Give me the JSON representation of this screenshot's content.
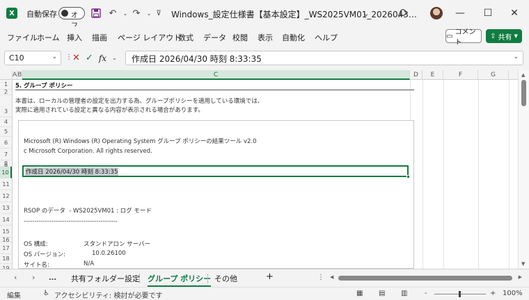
{
  "titlebar": {
    "app_icon": "X",
    "autosave_label": "自動保存",
    "toggle_label": "オフ",
    "doc_title": "Windows_設定仕様書【基本設定】_WS2025VM01_2026043…",
    "title_dropdown": "⌄"
  },
  "menu": [
    "ファイル",
    "ホーム",
    "挿入",
    "描画",
    "ページ レイアウト",
    "数式",
    "データ",
    "校閲",
    "表示",
    "自動化",
    "ヘルプ"
  ],
  "buttons": {
    "comment": "コメント",
    "share": "共有"
  },
  "formula": {
    "cell_ref": "C10",
    "content": "作成日 2026/04/30 時刻 8:33:35"
  },
  "columns": [
    "A",
    "B",
    "C",
    "D",
    "E",
    "F",
    "G"
  ],
  "rows": [
    "1",
    "2",
    "3",
    "4",
    "5",
    "6",
    "7",
    "8",
    "9",
    "10",
    "11",
    "12",
    "13",
    "14",
    "15",
    "16",
    "17",
    "18",
    "19"
  ],
  "sheet": {
    "heading": "5. グループ ポリシー",
    "note_line1": "本書は、ローカルの管理者の設定を出力する為、グループポリシーを適用している環境では、",
    "note_line2": "実際に適用されている設定と異なる内容が表示される場合があります。",
    "ms_line1": "Microsoft (R) Windows (R) Operating System グループ ポリシーの結果ツール v2.0",
    "ms_line2": "c Microsoft Corporation. All rights reserved.",
    "active_text": "作成日 2026/04/30 時刻 8:33:35",
    "rsop_title": "RSOP のデータ  - WS2025VM01 : ログ モード",
    "dashes": "--------------------------------------------",
    "os_config_label": "OS 構成:",
    "os_config_value": "スタンドアロン サーバー",
    "os_version_label": "OS バージョン:",
    "os_version_value": "10.0.26100",
    "site_label": "サイト名:",
    "site_value": "N/A"
  },
  "tabs": {
    "tab1": "共有フォルダー設定",
    "tab2": "グループ ポリシー",
    "tab3": "その他",
    "add": "+",
    "more": "…"
  },
  "status": {
    "mode": "編集",
    "accessibility": "アクセシビリティ: 検討が必要です",
    "zoom": "100%",
    "minus": "-",
    "plus": "+"
  },
  "colors": {
    "accent": "#107c41"
  }
}
